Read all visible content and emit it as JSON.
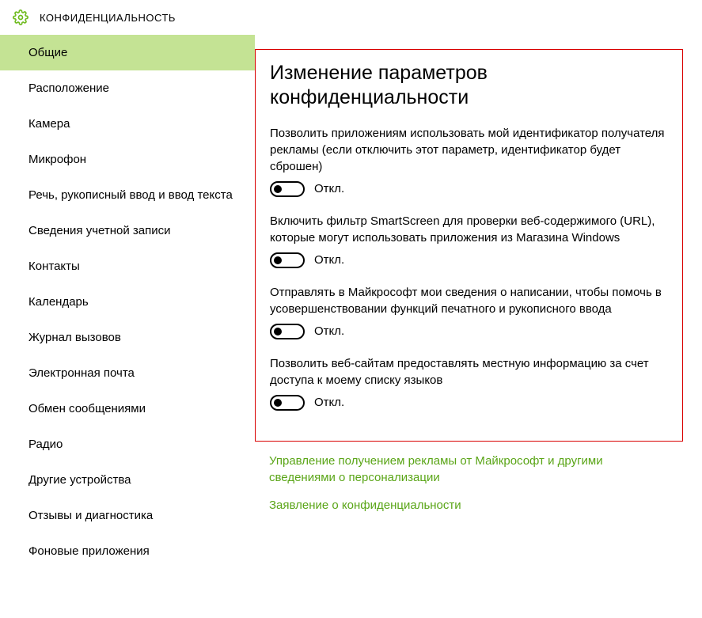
{
  "header": {
    "title": "КОНФИДЕНЦИАЛЬНОСТЬ"
  },
  "sidebar": {
    "items": [
      {
        "label": "Общие",
        "active": true
      },
      {
        "label": "Расположение",
        "active": false
      },
      {
        "label": "Камера",
        "active": false
      },
      {
        "label": "Микрофон",
        "active": false
      },
      {
        "label": "Речь, рукописный ввод и ввод текста",
        "active": false
      },
      {
        "label": "Сведения учетной записи",
        "active": false
      },
      {
        "label": "Контакты",
        "active": false
      },
      {
        "label": "Календарь",
        "active": false
      },
      {
        "label": "Журнал вызовов",
        "active": false
      },
      {
        "label": "Электронная почта",
        "active": false
      },
      {
        "label": "Обмен сообщениями",
        "active": false
      },
      {
        "label": "Радио",
        "active": false
      },
      {
        "label": "Другие устройства",
        "active": false
      },
      {
        "label": "Отзывы и диагностика",
        "active": false
      },
      {
        "label": "Фоновые приложения",
        "active": false
      }
    ]
  },
  "main": {
    "title": "Изменение параметров конфиденциальности",
    "settings": [
      {
        "desc": "Позволить приложениям использовать мой идентификатор получателя рекламы (если отключить этот параметр, идентификатор будет сброшен)",
        "state": "Откл."
      },
      {
        "desc": "Включить фильтр SmartScreen для проверки веб-содержимого (URL), которые могут использовать приложения из Магазина Windows",
        "state": "Откл."
      },
      {
        "desc": "Отправлять в Майкрософт мои сведения о написании, чтобы помочь в усовершенствовании функций печатного и рукописного ввода",
        "state": "Откл."
      },
      {
        "desc": "Позволить веб-сайтам предоставлять местную информацию за счет доступа к моему списку языков",
        "state": "Откл."
      }
    ],
    "links": [
      {
        "text": "Управление получением рекламы от Майкрософт и другими сведениями о персонализации"
      },
      {
        "text": "Заявление о конфиденциальности"
      }
    ]
  }
}
